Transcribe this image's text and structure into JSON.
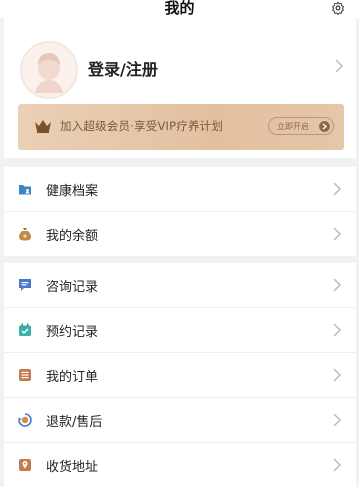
{
  "header": {
    "title": "我的"
  },
  "profile": {
    "login_label": "登录/注册",
    "vip_text": "加入超级会员·享受VIP疗养计划",
    "vip_button": "立即开启"
  },
  "menu_group_1": [
    {
      "label": "健康档案",
      "icon": "folder-icon",
      "color": "#3d86c6"
    },
    {
      "label": "我的余额",
      "icon": "money-bag-icon",
      "color": "#c08a48"
    }
  ],
  "menu_group_2": [
    {
      "label": "咨询记录",
      "icon": "chat-icon",
      "color": "#4a78c8"
    },
    {
      "label": "预约记录",
      "icon": "calendar-check-icon",
      "color": "#3ab0a8"
    },
    {
      "label": "我的订单",
      "icon": "list-icon",
      "color": "#c27d4a"
    },
    {
      "label": "退款/售后",
      "icon": "refund-icon",
      "color": "#4a78c8"
    },
    {
      "label": "收货地址",
      "icon": "location-icon",
      "color": "#c27d4a"
    }
  ],
  "colors": {
    "accent_gold": "#e3c0a0",
    "vip_text": "#7a5a3c"
  }
}
